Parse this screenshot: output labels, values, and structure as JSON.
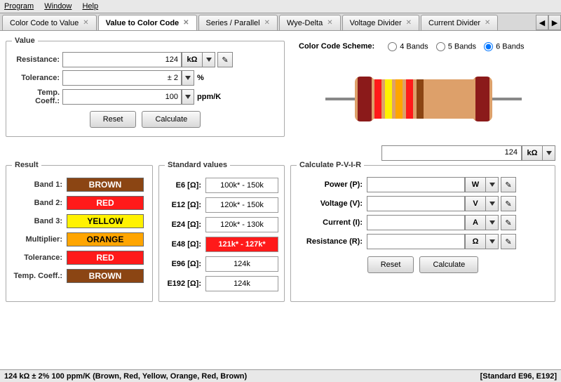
{
  "menu": {
    "program": "Program",
    "window": "Window",
    "help": "Help"
  },
  "tabs": [
    {
      "label": "Color Code to Value"
    },
    {
      "label": "Value to Color Code",
      "active": true
    },
    {
      "label": "Series / Parallel"
    },
    {
      "label": "Wye-Delta"
    },
    {
      "label": "Voltage Divider"
    },
    {
      "label": "Current Divider"
    }
  ],
  "value_group": {
    "legend": "Value",
    "resistance_label": "Resistance:",
    "resistance_value": "124",
    "resistance_unit": "kΩ",
    "tolerance_label": "Tolerance:",
    "tolerance_value": "± 2",
    "tolerance_unit": "%",
    "temp_label": "Temp. Coeff.:",
    "temp_value": "100",
    "temp_unit": "ppm/K",
    "reset": "Reset",
    "calculate": "Calculate"
  },
  "scheme": {
    "title": "Color Code Scheme:",
    "b4": "4 Bands",
    "b5": "5 Bands",
    "b6": "6 Bands",
    "selected": "6"
  },
  "display": {
    "value": "124",
    "unit": "kΩ"
  },
  "resistor_bands": [
    {
      "color": "#8B1A1A"
    },
    {
      "color": "#8B4513"
    },
    {
      "color": "#FF1A1A"
    },
    {
      "color": "#FFF200"
    },
    {
      "color": "#FFA500"
    },
    {
      "color": "#FF1A1A"
    },
    {
      "color": "#8B4513"
    },
    {
      "color": "#8B1A1A"
    }
  ],
  "result": {
    "legend": "Result",
    "rows": [
      {
        "label": "Band 1:",
        "text": "BROWN",
        "bg": "#8B4513",
        "fg": "#fff"
      },
      {
        "label": "Band 2:",
        "text": "RED",
        "bg": "#FF1A1A",
        "fg": "#fff"
      },
      {
        "label": "Band 3:",
        "text": "YELLOW",
        "bg": "#FFF200",
        "fg": "#000"
      },
      {
        "label": "Multiplier:",
        "text": "ORANGE",
        "bg": "#FFA500",
        "fg": "#000"
      },
      {
        "label": "Tolerance:",
        "text": "RED",
        "bg": "#FF1A1A",
        "fg": "#fff"
      },
      {
        "label": "Temp. Coeff.:",
        "text": "BROWN",
        "bg": "#8B4513",
        "fg": "#fff"
      }
    ]
  },
  "standard": {
    "legend": "Standard values",
    "rows": [
      {
        "label": "E6 [Ω]:",
        "value": "100k* - 150k"
      },
      {
        "label": "E12 [Ω]:",
        "value": "120k* - 150k"
      },
      {
        "label": "E24 [Ω]:",
        "value": "120k* - 130k"
      },
      {
        "label": "E48 [Ω]:",
        "value": "121k* - 127k*",
        "highlight": true
      },
      {
        "label": "E96 [Ω]:",
        "value": "124k"
      },
      {
        "label": "E192 [Ω]:",
        "value": "124k"
      }
    ]
  },
  "pvir": {
    "legend": "Calculate P-V-I-R",
    "rows": [
      {
        "label": "Power (P):",
        "unit": "W"
      },
      {
        "label": "Voltage (V):",
        "unit": "V"
      },
      {
        "label": "Current (I):",
        "unit": "A"
      },
      {
        "label": "Resistance (R):",
        "unit": "Ω"
      }
    ],
    "reset": "Reset",
    "calculate": "Calculate"
  },
  "status": {
    "left": "124 kΩ  ± 2%  100 ppm/K (Brown, Red, Yellow, Orange, Red, Brown)",
    "right": "[Standard E96, E192]"
  }
}
